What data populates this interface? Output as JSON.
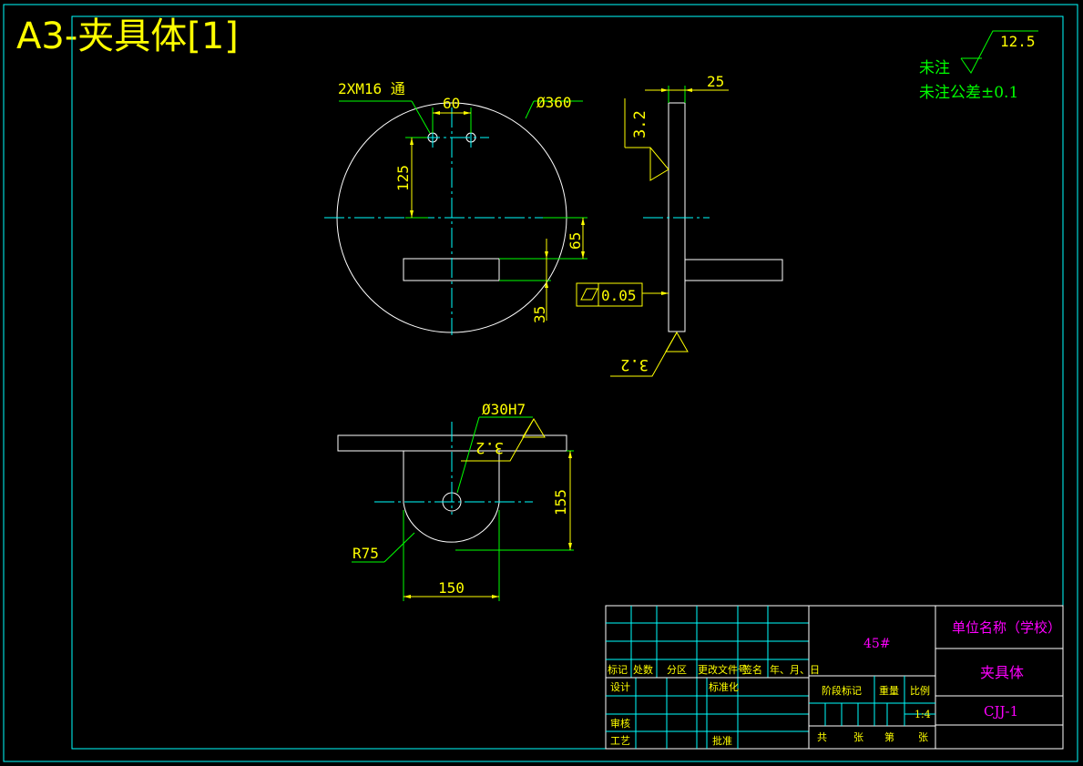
{
  "title": "A3-夹具体[1]",
  "colors": {
    "background": "#000000",
    "frame": "#00ffff",
    "outline": "#ffffff",
    "dimension": "#ffff00",
    "extension": "#00ff00",
    "centerline": "#00ffff",
    "titleblock_text": "#ff00ff"
  },
  "notes": {
    "roughness_value": "12.5",
    "unmarked": "未注",
    "unmarked_tolerance": "未注公差±0.1"
  },
  "front_view": {
    "hole_callout": "2XM16 通",
    "hole_spacing": "60",
    "diameter": "Ø360",
    "hole_height": "125",
    "slot_offset": "65",
    "slot_width": "35"
  },
  "side_view": {
    "thickness": "25",
    "roughness_top": "3.2",
    "flatness_symbol": "▱",
    "flatness_value": "0.05",
    "roughness_bottom": "3.2"
  },
  "bottom_view": {
    "bore": "Ø30H7",
    "roughness": "3.2",
    "height": "155",
    "radius": "R75",
    "width": "150"
  },
  "title_block": {
    "revision_headers": [
      "标记",
      "处数",
      "分区",
      "更改文件号",
      "签名",
      "年、月、日"
    ],
    "design": "设计",
    "standardization": "标准化",
    "review": "审核",
    "process": "工艺",
    "approval": "批准",
    "material": "45#",
    "stage_mark": "阶段标记",
    "weight": "重量",
    "scale_label": "比例",
    "scale_value": "1:4",
    "sheet_total": "共",
    "sheet_unit": "张",
    "sheet_no": "第",
    "sheet_unit2": "张",
    "company": "单位名称（学校）",
    "part_name": "夹具体",
    "drawing_no": "CJJ-1"
  }
}
